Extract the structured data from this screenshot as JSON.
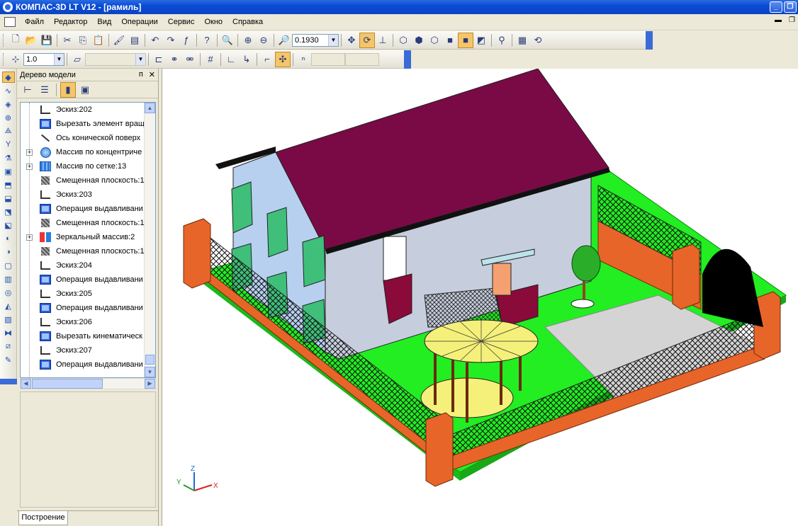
{
  "window": {
    "title": "КОМПАС-3D LT V12 - [рамиль]",
    "minimize": "_",
    "restore": "❐"
  },
  "menu": [
    "Файл",
    "Редактор",
    "Вид",
    "Операции",
    "Сервис",
    "Окно",
    "Справка"
  ],
  "toolbar": {
    "zoom_value": "0.1930",
    "step_value": "1.0"
  },
  "panel": {
    "title": "Дерево модели",
    "pin": "ᴨ",
    "close": "✕",
    "tab": "Построение"
  },
  "tree": [
    {
      "label": "Эскиз:202",
      "icon": "sketch-icon",
      "expandable": false
    },
    {
      "label": "Вырезать элемент вращ",
      "icon": "cut-revolve-icon",
      "expandable": false
    },
    {
      "label": "Ось конической поверх",
      "icon": "axis-icon",
      "expandable": false
    },
    {
      "label": "Массив по концентриче",
      "icon": "circular-array-icon",
      "expandable": true
    },
    {
      "label": "Массив по сетке:13",
      "icon": "grid-array-icon",
      "expandable": true
    },
    {
      "label": "Смещенная плоскость:1",
      "icon": "plane-icon",
      "expandable": false
    },
    {
      "label": "Эскиз:203",
      "icon": "sketch-icon",
      "expandable": false
    },
    {
      "label": "Операция выдавливани",
      "icon": "extrude-icon",
      "expandable": false
    },
    {
      "label": "Смещенная плоскость:1",
      "icon": "plane-icon",
      "expandable": false
    },
    {
      "label": "Зеркальный массив:2",
      "icon": "mirror-array-icon",
      "expandable": true
    },
    {
      "label": "Смещенная плоскость:1",
      "icon": "plane-icon",
      "expandable": false
    },
    {
      "label": "Эскиз:204",
      "icon": "sketch-icon",
      "expandable": false
    },
    {
      "label": "Операция выдавливани",
      "icon": "extrude-icon",
      "expandable": false
    },
    {
      "label": "Эскиз:205",
      "icon": "sketch-icon",
      "expandable": false
    },
    {
      "label": "Операция выдавливани",
      "icon": "extrude-icon",
      "expandable": false
    },
    {
      "label": "Эскиз:206",
      "icon": "sketch-icon",
      "expandable": false
    },
    {
      "label": "Вырезать кинематическ",
      "icon": "cut-sweep-icon",
      "expandable": false
    },
    {
      "label": "Эскиз:207",
      "icon": "sketch-icon",
      "expandable": false
    },
    {
      "label": "Операция выдавливани",
      "icon": "extrude-icon",
      "expandable": false
    }
  ],
  "axes": {
    "x": "X",
    "y": "Y",
    "z": "Z"
  },
  "colors": {
    "roof": "#7a0a45",
    "wall": "#b8d0f0",
    "grass": "#22ee22",
    "fence_brick": "#e8652a",
    "path": "#d4d4d4",
    "gazebo": "#f5f07a",
    "title_bar": "#0a4bd6"
  }
}
